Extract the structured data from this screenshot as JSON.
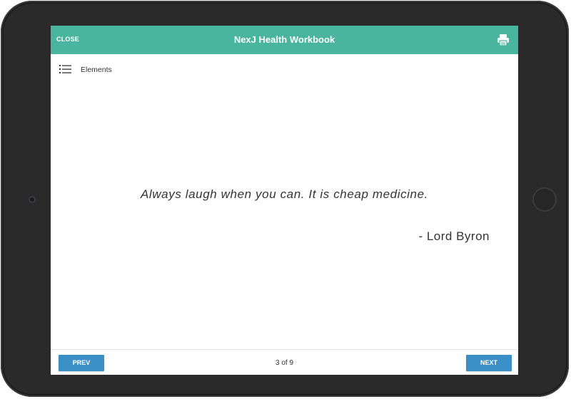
{
  "app": {
    "title": "NexJ Health Workbook",
    "close_label": "CLOSE",
    "header_color": "#4ab59e"
  },
  "toolbar": {
    "elements_label": "Elements",
    "menu_icon": "list-icon",
    "print_icon": "printer-icon"
  },
  "content": {
    "quote": "Always laugh when you can. It is cheap medicine.",
    "author": "- Lord Byron"
  },
  "footer": {
    "prev_label": "PREV",
    "next_label": "NEXT",
    "page_indicator": "3 of 9",
    "button_color": "#3a8fc6"
  }
}
